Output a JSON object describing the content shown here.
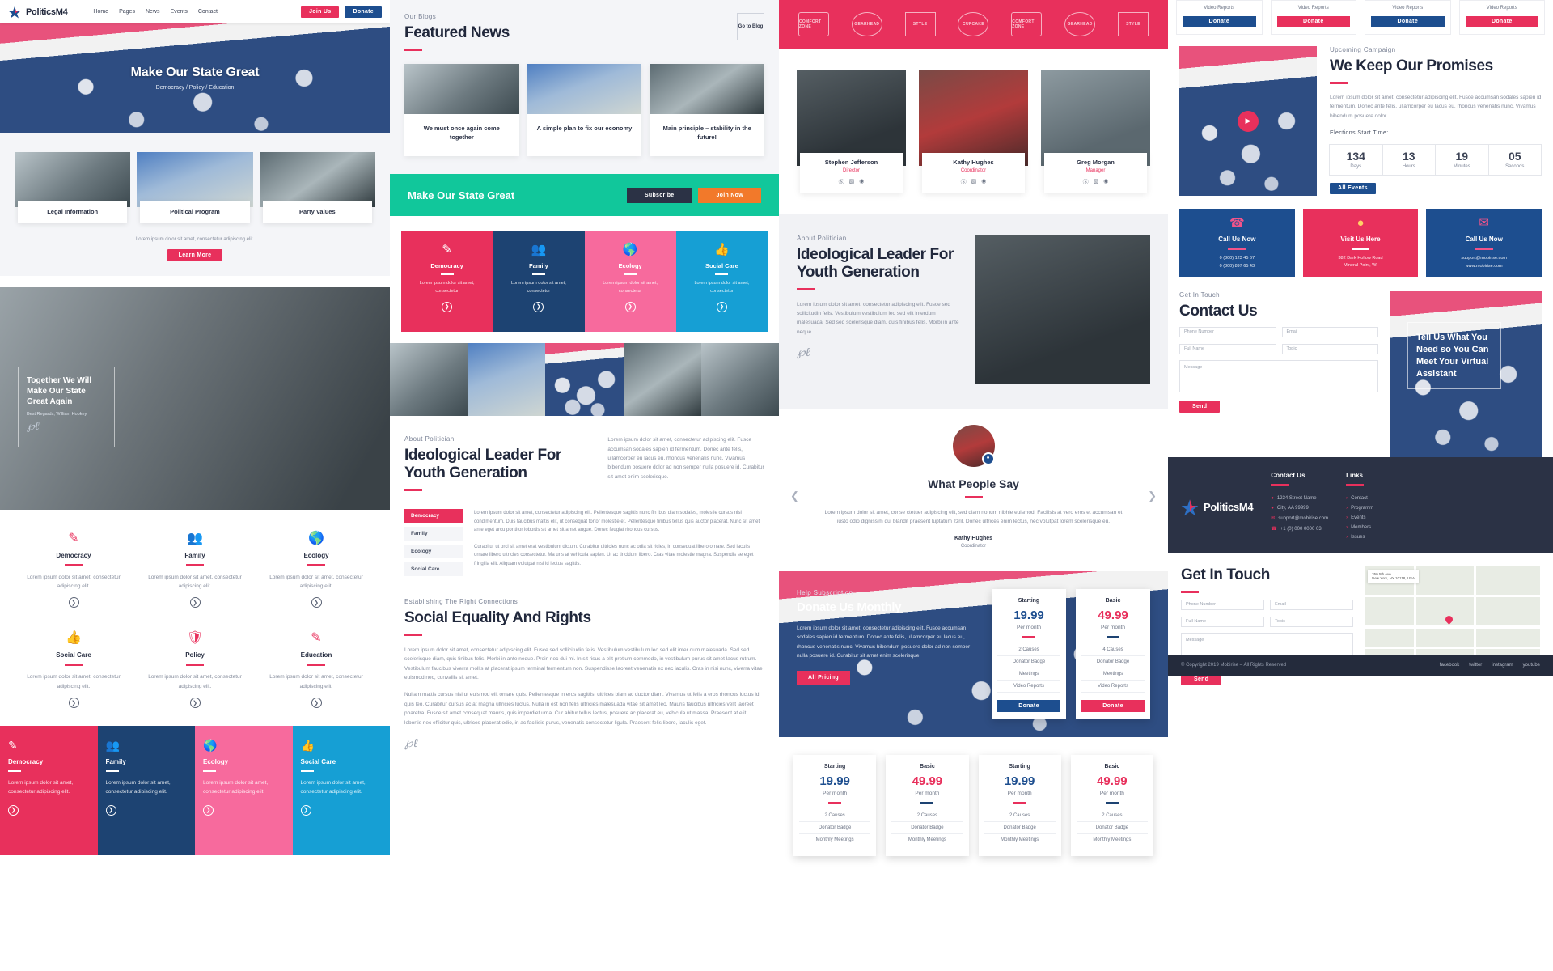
{
  "brand": {
    "name": "PoliticsM4"
  },
  "nav": {
    "links": [
      "Home",
      "Pages",
      "News",
      "Events",
      "Contact"
    ],
    "join_label": "Join Us",
    "donate_label": "Donate"
  },
  "hero": {
    "title": "Make Our State Great",
    "subtitle": "Democracy / Policy / Education"
  },
  "cards3": {
    "items": [
      {
        "label": "Legal Information"
      },
      {
        "label": "Political Program"
      },
      {
        "label": "Party Values"
      }
    ],
    "note": "Lorem ipsum dolor sit amet, consectetur adipiscing elit.",
    "learn_more": "Learn More"
  },
  "quote": {
    "title": "Together We Will Make Our State Great Again",
    "caption": "Best Regards, William Hopkey"
  },
  "features": [
    {
      "icon": "document-edit-icon",
      "title": "Democracy",
      "text": "Lorem ipsum dolor sit amet, consectetur adipiscing elit."
    },
    {
      "icon": "family-icon",
      "title": "Family",
      "text": "Lorem ipsum dolor sit amet, consectetur adipiscing elit."
    },
    {
      "icon": "ecology-globe-icon",
      "title": "Ecology",
      "text": "Lorem ipsum dolor sit amet, consectetur adipiscing elit."
    },
    {
      "icon": "thumbs-up-icon",
      "title": "Social Care",
      "text": "Lorem ipsum dolor sit amet, consectetur adipiscing elit."
    },
    {
      "icon": "shield-icon",
      "title": "Policy",
      "text": "Lorem ipsum dolor sit amet, consectetur adipiscing elit."
    },
    {
      "icon": "education-pen-icon",
      "title": "Education",
      "text": "Lorem ipsum dolor sit amet, consectetur adipiscing elit."
    }
  ],
  "color_strip": [
    {
      "icon": "document-edit-icon",
      "title": "Democracy",
      "text": "Lorem ipsum dolor sit amet, consectetur adipiscing elit.",
      "color": "#e8305c"
    },
    {
      "icon": "family-icon",
      "title": "Family",
      "text": "Lorem ipsum dolor sit amet, consectetur adipiscing elit.",
      "color": "#1d4372"
    },
    {
      "icon": "ecology-globe-icon",
      "title": "Ecology",
      "text": "Lorem ipsum dolor sit amet, consectetur adipiscing elit.",
      "color": "#f76a9d"
    },
    {
      "icon": "thumbs-up-icon",
      "title": "Social Care",
      "text": "Lorem ipsum dolor sit amet, consectetur adipiscing elit.",
      "color": "#169fd4"
    }
  ],
  "blog": {
    "eyebrow": "Our Blogs",
    "title": "Featured News",
    "go_to_blog": "Go to Blog",
    "posts": [
      {
        "title": "We must once again come together"
      },
      {
        "title": "A simple plan to fix our economy"
      },
      {
        "title": "Main principle – stability in the future!"
      }
    ]
  },
  "cta": {
    "title": "Make Our State Great",
    "subscribe": "Subscribe",
    "join_now": "Join Now"
  },
  "pillars": [
    {
      "icon": "document-edit-icon",
      "title": "Democracy",
      "text": "Lorem ipsum dolor sit amet, consectetur",
      "color": "#e8305c"
    },
    {
      "icon": "family-icon",
      "title": "Family",
      "text": "Lorem ipsum dolor sit amet, consectetur",
      "color": "#1d4372"
    },
    {
      "icon": "ecology-globe-icon",
      "title": "Ecology",
      "text": "Lorem ipsum dolor sit amet, consectetur",
      "color": "#f76a9d"
    },
    {
      "icon": "thumbs-up-icon",
      "title": "Social Care",
      "text": "Lorem ipsum dolor sit amet, consectetur",
      "color": "#169fd4"
    }
  ],
  "about": {
    "eyebrow": "About Politician",
    "title": "Ideological Leader For Youth Generation",
    "text": "Lorem ipsum dolor sit amet, consectetur adipiscing elit. Fusce accumsan sodales sapien id fermentum. Donec ante felis, ullamcorper eu lacus eu, rhoncus venenatis nunc. Vivamus bibendum posuere dolor ad non semper nulla posuere id. Curabitur sit amet enim scelerisque."
  },
  "about3": {
    "eyebrow": "About Politician",
    "title": "Ideological Leader For Youth Generation",
    "text": "Lorem ipsum dolor sit amet, consectetur adipiscing elit. Fusce sed sollicitudin felis. Vestibulum vestibulum leo sed elit interdum malesuada. Sed sed scelerisque diam, quis finibus felis. Morbi in ante neque."
  },
  "tabs": {
    "items": [
      "Democracy",
      "Family",
      "Ecology",
      "Social Care"
    ],
    "active": "Democracy",
    "body1": "Lorem ipsum dolor sit amet, consectetur adipiscing elit. Pellentesque sagittis nunc fin ibus diam sodales, molestie cursus nisl condimentum. Duis faucibus mattis elit, ut consequat tortor molestie et. Pellentesque finibus tellus quis auctor placerat. Nunc sit amet ante eget arcu porttitor lobortis sit amet sit amet augue. Donec feugiat rhoncus cursus.",
    "body2": "Curabitur ut orci sit amet erat vestibulum dictum. Curabitur ultricies nunc ac odia sit ricies, in consequat libero ornare. Sed iaculis ornare libero ultricies consectetur. Ma uris at vehicula sapien. Ut ac tincidunt libero. Cras vitae molestie magna. Suspendis se eget fringilla elit. Aliquam volutpat nisi id lectus sagittis."
  },
  "social_equality": {
    "eyebrow": "Establishing The Right Connections",
    "title": "Social Equality And Rights",
    "p1": "Lorem ipsum dolor sit amet, consectetur adipiscing elit. Fusce sed sollicitudin felis. Vestibulum vestibulum leo sed elit inter dum malesuada. Sed sed scelerisque diam, quis finibus felis. Morbi in ante neque. Proin nec dui mi. In sit risus a elit pretium commodo, in vestibulum purus sit amet lacus rutrum. Vestibulum faucibus viverra mollis at placerat ipsum terminal fermentum non. Suspendisse laoreet venenatis ex nec iaculis. Cras in nisi nunc, viverra vitae euismod nec, convallis sit amet.",
    "p2": "Nullam mattis cursus nisi ut euismod elit ornare quis. Pellentesque in eros sagittis, ultrices biam ac ductor diam. Vivamus ut felis a eros rhoncus luctus id quis leo. Curabitur cursus ac at magna ultricies luctus. Nulla in est non felis ultricies malesuada vitae sit amet leo. Mauris faucibus ultricies velit laoreet pharetra. Fusce sit amet consequat mauris, quis imperdiet urna. Cur abitur tellus lectus, posuere ac placerat eu, vehicula ut massa. Praesent at elit, lobortis nec efficitur quis, ultrices placerat odio, in ac facilisis purus, venenatis consectetur ligula. Praesent felis libero, iaculis eget."
  },
  "logos": [
    "COMFORT ZONE",
    "GEARHEAD",
    "STYLE",
    "CUPCAKE",
    "COMFORT ZONE",
    "GEARHEAD",
    "STYLE"
  ],
  "team": [
    {
      "name": "Stephen Jefferson",
      "role": "Director"
    },
    {
      "name": "Kathy Hughes",
      "role": "Coordinator"
    },
    {
      "name": "Greg Morgan",
      "role": "Manager"
    }
  ],
  "testimonial": {
    "title": "What People Say",
    "text": "Lorem ipsum dolor sit amet, conse ctetuer adipiscing elit, sed diam nonum nibhie euismod. Facilisis at vero eros et accumsan et iusto odio dignissim qui blandit praesent luptatum zzril. Donec ultrices enim lectus, nec volutpat lorem scelerisque eu.",
    "author": "Kathy Hughes",
    "role": "Coordinator"
  },
  "donate": {
    "eyebrow": "Help Subscription",
    "title": "Donate Us Monthly",
    "text": "Lorem ipsum dolor sit amet, consectetur adipiscing elit. Fusce accumsan sodales sapien id fermentum. Donec ante felis, ullamcorper eu lacus eu, rhoncus venenatis nunc. Vivamus bibendum posuere dolor ad non semper nulla posuere id. Curabitur sit amet enim scelerisque.",
    "all_pricing": "All Pricing",
    "donate_label": "Donate",
    "plans": [
      {
        "name": "Starting",
        "price": "19.99",
        "period": "Per month",
        "accent": "#e8305c",
        "features": [
          "2 Causes",
          "Donator Badge",
          "Meetings",
          "Video Reports"
        ],
        "btn_color": "#1d4e8f"
      },
      {
        "name": "Basic",
        "price": "49.99",
        "period": "Per month",
        "accent": "#1d4372",
        "features": [
          "4 Causes",
          "Donator Badge",
          "Meetings",
          "Video Reports"
        ],
        "btn_color": "#e8305c"
      }
    ]
  },
  "plans_row": [
    {
      "name": "Starting",
      "price": "19.99",
      "period": "Per month",
      "price_color": "#1d4e8f",
      "accent": "#e8305c",
      "features": [
        "2 Causes",
        "Donator Badge",
        "Monthly Meetings"
      ]
    },
    {
      "name": "Basic",
      "price": "49.99",
      "period": "Per month",
      "price_color": "#e8305c",
      "accent": "#1d4372",
      "features": [
        "2 Causes",
        "Donator Badge",
        "Monthly Meetings"
      ]
    },
    {
      "name": "Starting",
      "price": "19.99",
      "period": "Per month",
      "price_color": "#1d4e8f",
      "accent": "#e8305c",
      "features": [
        "2 Causes",
        "Donator Badge",
        "Monthly Meetings"
      ]
    },
    {
      "name": "Basic",
      "price": "49.99",
      "period": "Per month",
      "price_color": "#e8305c",
      "accent": "#1d4372",
      "features": [
        "2 Causes",
        "Donator Badge",
        "Monthly Meetings"
      ]
    }
  ],
  "donor_row": [
    {
      "label": "Video Reports",
      "btn": "Donate",
      "btn_color": "#1d4e8f"
    },
    {
      "label": "Video Reports",
      "btn": "Donate",
      "btn_color": "#e8305c"
    },
    {
      "label": "Video Reports",
      "btn": "Donate",
      "btn_color": "#1d4e8f"
    },
    {
      "label": "Video Reports",
      "btn": "Donate",
      "btn_color": "#e8305c"
    }
  ],
  "promises": {
    "eyebrow": "Upcoming Campaign",
    "title": "We Keep Our Promises",
    "text": "Lorem ipsum dolor sit amet, consectetur adipiscing elit. Fusce accumsan sodales sapien id fermentum. Donec ante felis, ullamcorper eu lacus eu, rhoncus venenatis nunc. Vivamus bibendum posuere dolor.",
    "countdown_label": "Elections Start Time:",
    "countdown": [
      {
        "value": "134",
        "label": "Days"
      },
      {
        "value": "13",
        "label": "Hours"
      },
      {
        "value": "19",
        "label": "Minutes"
      },
      {
        "value": "05",
        "label": "Seconds"
      }
    ],
    "all_events": "All Events"
  },
  "contact_cards": [
    {
      "icon": "phone-icon",
      "title": "Call Us Now",
      "lines": [
        "0 (800) 123 45 67",
        "0 (800) 897 65 43"
      ],
      "color": "#1d4e8f"
    },
    {
      "icon": "map-pin-icon",
      "title": "Visit Us Here",
      "lines": [
        "382 Dark Hollow Road",
        "Mineral Point, WI"
      ],
      "color": "#e8305c"
    },
    {
      "icon": "mail-edit-icon",
      "title": "Call Us Now",
      "lines": [
        "support@mobirise.com",
        "www.mobirise.com"
      ],
      "color": "#1d4e8f"
    }
  ],
  "contact_form": {
    "eyebrow": "Get In Touch",
    "title": "Contact Us",
    "placeholders": {
      "phone": "Phone Number",
      "email": "Email",
      "name": "Full Name",
      "topic": "Topic",
      "message": "Message"
    },
    "send": "Send"
  },
  "assistant": {
    "title": "Tell Us What You Need so You Can Meet Your Virtual Assistant"
  },
  "footer": {
    "contact_heading": "Contact Us",
    "contact_items": [
      {
        "icon": "pin-icon",
        "text": "1234 Street Name"
      },
      {
        "icon": "pin-icon",
        "text": "City, AA 99999"
      },
      {
        "icon": "mail-icon",
        "text": "support@mobirise.com"
      },
      {
        "icon": "phone-icon",
        "text": "+1 (0) 000 0000 03"
      }
    ],
    "links_heading": "Links",
    "links": [
      "Contact",
      "Programm",
      "Events",
      "Members",
      "Issues"
    ],
    "get_in_touch": "Get In Touch",
    "placeholders": {
      "phone": "Phone Number",
      "email": "Email",
      "name": "Full Name",
      "topic": "Topic",
      "message": "Message"
    },
    "send": "Send",
    "copyright": "© Copyright 2019 Mobirise – All Rights Reserved",
    "socials": [
      "facebook",
      "twitter",
      "instagram",
      "youtube"
    ],
    "map": {
      "address": "350 5th Ave",
      "sub": "New York, NY 10118, USA"
    }
  }
}
